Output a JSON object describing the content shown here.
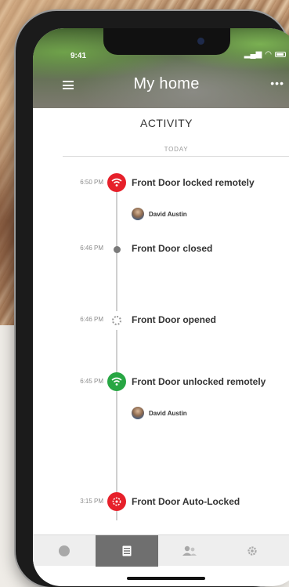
{
  "status": {
    "time": "9:41"
  },
  "header": {
    "title": "My home"
  },
  "activity": {
    "title": "ACTIVITY",
    "section": "TODAY",
    "events": [
      {
        "time": "6:50 PM",
        "text": "Front Door locked remotely",
        "user": "David Austin",
        "icon": "wifi-icon",
        "color": "#e6202a"
      },
      {
        "time": "6:46 PM",
        "text": "Front Door closed",
        "icon": "dot-icon",
        "color": "#777777"
      },
      {
        "time": "6:46 PM",
        "text": "Front Door opened",
        "icon": "spinner-icon",
        "color": "#9a9a9a"
      },
      {
        "time": "6:45 PM",
        "text": "Front Door unlocked remotely",
        "user": "David Austin",
        "icon": "wifi-icon",
        "color": "#27a643"
      },
      {
        "time": "3:15 PM",
        "text": "Front Door Auto-Locked",
        "icon": "auto-lock-icon",
        "color": "#e6202a"
      }
    ]
  },
  "tabs": [
    "home-tab",
    "activity-tab",
    "users-tab",
    "settings-tab"
  ],
  "colors": {
    "red": "#e6202a",
    "green": "#27a643",
    "active_tab": "#6f6f6f"
  }
}
